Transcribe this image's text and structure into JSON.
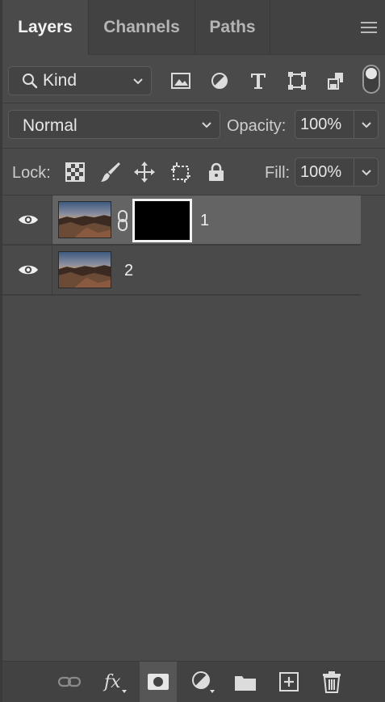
{
  "tabs": [
    {
      "label": "Layers",
      "active": true
    },
    {
      "label": "Channels",
      "active": false
    },
    {
      "label": "Paths",
      "active": false
    }
  ],
  "filter": {
    "kind_label": "Kind",
    "icons": [
      "image-filter-icon",
      "adjustment-filter-icon",
      "type-filter-icon",
      "shape-filter-icon",
      "smart-object-filter-icon"
    ]
  },
  "blend": {
    "mode": "Normal",
    "opacity_label": "Opacity:",
    "opacity_value": "100%"
  },
  "lock": {
    "label": "Lock:",
    "icons": [
      "lock-transparent-pixels-icon",
      "lock-image-pixels-icon",
      "lock-position-icon",
      "lock-artboard-icon",
      "lock-all-icon"
    ],
    "fill_label": "Fill:",
    "fill_value": "100%"
  },
  "layers": [
    {
      "name": "1",
      "visible": true,
      "selected": true,
      "has_mask": true
    },
    {
      "name": "2",
      "visible": true,
      "selected": false,
      "has_mask": false
    }
  ],
  "bottom_toolbar": [
    "link-layers-icon",
    "fx-icon",
    "add-mask-icon",
    "adjustment-layer-icon",
    "new-group-icon",
    "new-layer-icon",
    "delete-icon"
  ],
  "colors": {
    "panel_bg": "#4a4a4a",
    "selected_row": "#646464",
    "text": "#e6e6e6"
  }
}
